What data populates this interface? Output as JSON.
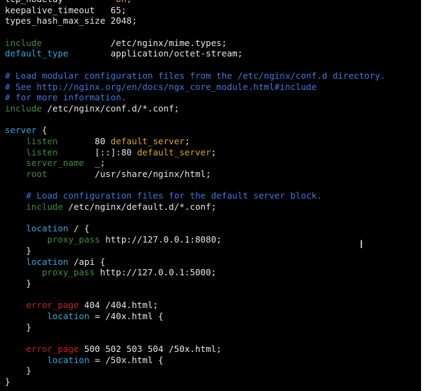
{
  "colors": {
    "text": "#e6e6e6",
    "keyword": "#2fa8d8",
    "directive": "#3f8b3f",
    "comment": "#3a78e0",
    "string": "#d9a51a",
    "error": "#c51f1f"
  },
  "mouse": {
    "icon": "text-cursor-icon",
    "glyph": "I"
  },
  "lines": [
    [
      {
        "t": "tcp_nodelay",
        "c": "text"
      },
      {
        "t": "          ",
        "c": "text"
      },
      {
        "t": "on;",
        "c": "string"
      }
    ],
    [
      {
        "t": "keepalive_timeout   65;",
        "c": "text"
      }
    ],
    [
      {
        "t": "types_hash_max_size 2048;",
        "c": "text"
      }
    ],
    [],
    [
      {
        "t": "include",
        "c": "directive"
      },
      {
        "t": "             /etc/nginx/mime.types;",
        "c": "text"
      }
    ],
    [
      {
        "t": "default_type",
        "c": "keyword"
      },
      {
        "t": "        application/octet-stream;",
        "c": "text"
      }
    ],
    [],
    [
      {
        "t": "# Load modular configuration files from the /etc/nginx/conf.d directory.",
        "c": "comment"
      }
    ],
    [
      {
        "t": "# See http://nginx.org/en/docs/ngx_core_module.html#include",
        "c": "comment"
      }
    ],
    [
      {
        "t": "# for more information.",
        "c": "comment"
      }
    ],
    [
      {
        "t": "include",
        "c": "directive"
      },
      {
        "t": " /etc/nginx/conf.d/*.conf;",
        "c": "text"
      }
    ],
    [],
    [
      {
        "t": "server",
        "c": "keyword"
      },
      {
        "t": " {",
        "c": "text"
      }
    ],
    [
      {
        "t": "    listen",
        "c": "directive"
      },
      {
        "t": "       80 ",
        "c": "text"
      },
      {
        "t": "default_server",
        "c": "string"
      },
      {
        "t": ";",
        "c": "text"
      }
    ],
    [
      {
        "t": "    listen",
        "c": "directive"
      },
      {
        "t": "       [::]:80 ",
        "c": "text"
      },
      {
        "t": "default_server",
        "c": "string"
      },
      {
        "t": ";",
        "c": "text"
      }
    ],
    [
      {
        "t": "    server_name",
        "c": "directive"
      },
      {
        "t": "  _;",
        "c": "text"
      }
    ],
    [
      {
        "t": "    root",
        "c": "directive"
      },
      {
        "t": "         /usr/share/nginx/html;",
        "c": "text"
      }
    ],
    [],
    [
      {
        "t": "    # Load configuration files for the default server block.",
        "c": "comment"
      }
    ],
    [
      {
        "t": "    include",
        "c": "directive"
      },
      {
        "t": " /etc/nginx/default.d/*.conf;",
        "c": "text"
      }
    ],
    [],
    [
      {
        "t": "    location",
        "c": "keyword"
      },
      {
        "t": " / {",
        "c": "text"
      }
    ],
    [
      {
        "t": "        proxy_pass",
        "c": "directive"
      },
      {
        "t": " http://127.0.0.1:8080;",
        "c": "text"
      }
    ],
    [
      {
        "t": "    }",
        "c": "text"
      }
    ],
    [
      {
        "t": "    location",
        "c": "keyword"
      },
      {
        "t": " /api {",
        "c": "text"
      }
    ],
    [
      {
        "t": "       proxy_pass",
        "c": "directive"
      },
      {
        "t": " http://127.0.0.1:5000;",
        "c": "text"
      }
    ],
    [
      {
        "t": "    }",
        "c": "text"
      }
    ],
    [],
    [
      {
        "t": "    error_page",
        "c": "error"
      },
      {
        "t": " 404 /404.html;",
        "c": "text"
      }
    ],
    [
      {
        "t": "        location",
        "c": "keyword"
      },
      {
        "t": " = /40x.html {",
        "c": "text"
      }
    ],
    [
      {
        "t": "    }",
        "c": "text"
      }
    ],
    [],
    [
      {
        "t": "    error_page",
        "c": "error"
      },
      {
        "t": " 500 502 503 504 /50x.html;",
        "c": "text"
      }
    ],
    [
      {
        "t": "        location",
        "c": "keyword"
      },
      {
        "t": " = /50x.html {",
        "c": "text"
      }
    ],
    [
      {
        "t": "    }",
        "c": "text"
      }
    ],
    [
      {
        "t": "}",
        "c": "text"
      }
    ]
  ]
}
